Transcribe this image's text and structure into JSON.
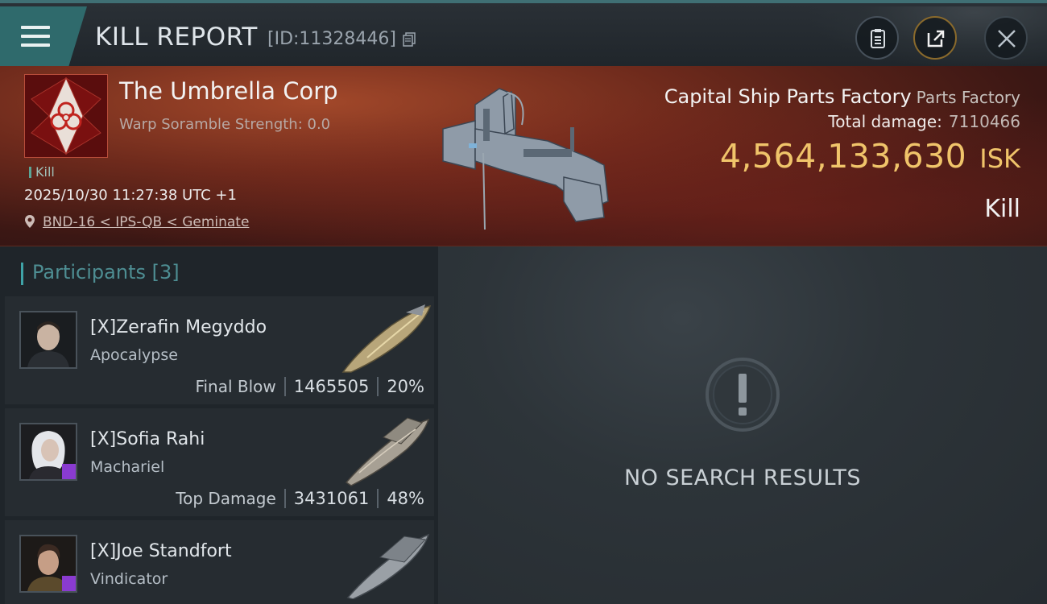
{
  "header": {
    "title": "KILL REPORT",
    "report_id": "[ID:11328446]"
  },
  "victim": {
    "corp_name": "The Umbrella Corp",
    "warp_scramble": "Warp Soramble Strength: 0.0",
    "tag": "Kill",
    "timestamp": "2025/10/30 11:27:38 UTC +1",
    "location": "BND-16 < IPS-QB < Geminate",
    "ship_name": "Capital Ship Parts Factory",
    "ship_class": "Parts Factory",
    "damage_label": "Total damage:",
    "damage_value": "7110466",
    "isk_value": "4,564,133,630",
    "isk_unit": "ISK",
    "result": "Kill"
  },
  "participants": {
    "header_label": "Participants",
    "header_count": "[3]",
    "items": [
      {
        "name": "[X]Zerafin Megyddo",
        "ship": "Apocalypse",
        "role": "Final Blow",
        "damage": "1465505",
        "percent": "20%"
      },
      {
        "name": "[X]Sofia Rahi",
        "ship": "Machariel",
        "role": "Top Damage",
        "damage": "3431061",
        "percent": "48%"
      },
      {
        "name": "[X]Joe Standfort",
        "ship": "Vindicator"
      }
    ]
  },
  "results": {
    "empty_text": "NO SEARCH RESULTS"
  },
  "icons": {
    "menu": "hamburger-icon",
    "copy": "copy-icon",
    "clipboard": "clipboard-icon",
    "share": "share-icon",
    "close": "close-icon",
    "location": "location-pin-icon",
    "empty": "exclamation-icon"
  },
  "colors": {
    "accent": "#3fa3a7",
    "isk": "#f0c46a",
    "banner": "#6e2a1c"
  }
}
